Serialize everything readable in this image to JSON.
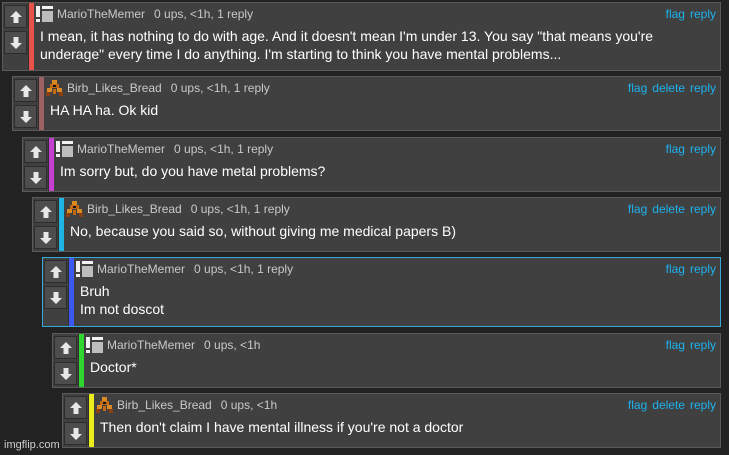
{
  "thread": {
    "comments": [
      {
        "username": "MarioTheMemer",
        "avatar": "meme-logo-icon",
        "meta": "0 ups, <1h, 1 reply",
        "actions": [
          "flag",
          "reply"
        ],
        "lines": [
          "I mean, it has nothing to do with age. And it doesn't mean I'm under 13. You say \"that means you're",
          "underage\" every time I do anything. I'm starting to think you have mental problems..."
        ],
        "bar_color": "#e8524a"
      },
      {
        "username": "Birb_Likes_Bread",
        "avatar": "pixel-creature-icon",
        "meta": "0 ups, <1h, 1 reply",
        "actions": [
          "flag",
          "delete",
          "reply"
        ],
        "lines": [
          "HA HA ha. Ok kid"
        ],
        "bar_color": "#9e6262"
      },
      {
        "username": "MarioTheMemer",
        "avatar": "meme-logo-icon",
        "meta": "0 ups, <1h, 1 reply",
        "actions": [
          "flag",
          "reply"
        ],
        "lines": [
          "Im sorry but, do you have metal problems?"
        ],
        "bar_color": "#c63fd1"
      },
      {
        "username": "Birb_Likes_Bread",
        "avatar": "pixel-creature-icon",
        "meta": "0 ups, <1h, 1 reply",
        "actions": [
          "flag",
          "delete",
          "reply"
        ],
        "lines": [
          "No, because you said so, without giving me medical papers B)"
        ],
        "bar_color": "#1fb6e6"
      },
      {
        "username": "MarioTheMemer",
        "avatar": "meme-logo-icon",
        "meta": "0 ups, <1h, 1 reply",
        "actions": [
          "flag",
          "reply"
        ],
        "lines": [
          "Bruh",
          "Im not doscot"
        ],
        "bar_color": "#3d58f0"
      },
      {
        "username": "MarioTheMemer",
        "avatar": "meme-logo-icon",
        "meta": "0 ups, <1h",
        "actions": [
          "flag",
          "reply"
        ],
        "lines": [
          "Doctor*"
        ],
        "bar_color": "#2fd62f"
      },
      {
        "username": "Birb_Likes_Bread",
        "avatar": "pixel-creature-icon",
        "meta": "0 ups, <1h",
        "actions": [
          "flag",
          "delete",
          "reply"
        ],
        "lines": [
          "Then don't claim I have mental illness if you're not a doctor"
        ],
        "bar_color": "#ecec1c"
      }
    ]
  },
  "watermark": "imgflip.com",
  "colors": {
    "background": "#222222",
    "panel": "#404040",
    "link": "#1db2ef",
    "text": "#ffffff",
    "meta_text": "#c9c9c9"
  }
}
